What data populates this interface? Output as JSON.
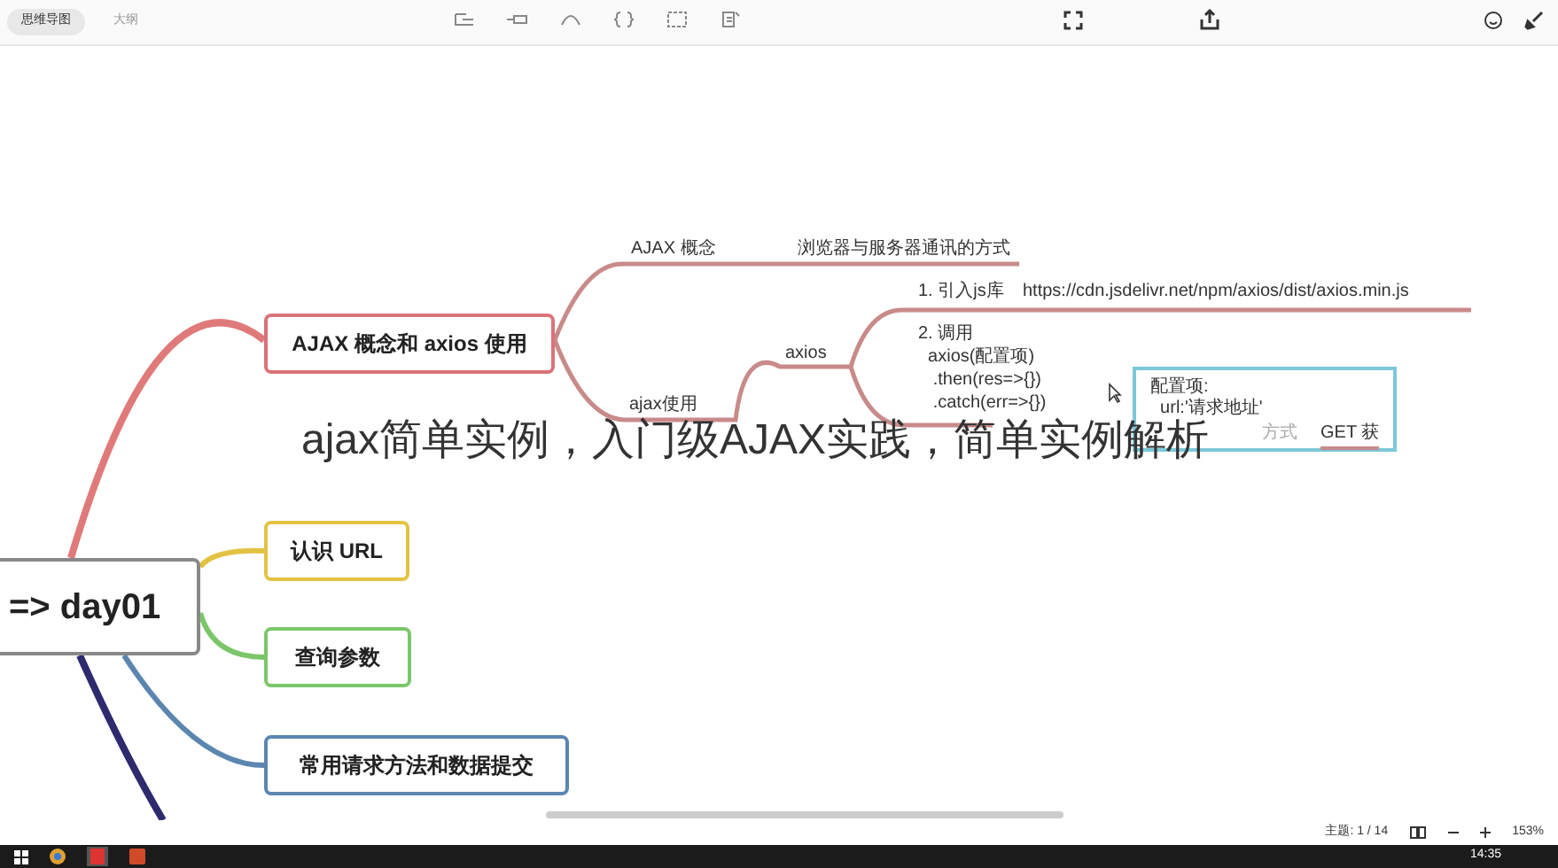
{
  "tabs": [
    {
      "label": "思维导图",
      "selected": true
    },
    {
      "label": "大纲",
      "selected": false
    }
  ],
  "mind_map": {
    "root": "=> day01",
    "topics": [
      {
        "label": "AJAX 概念和 axios 使用",
        "color": "#d9737a"
      },
      {
        "label": "认识 URL",
        "color": "#e3c243"
      },
      {
        "label": "查询参数",
        "color": "#7cc66a"
      },
      {
        "label": "常用请求方法和数据提交",
        "color": "#5b86b0"
      }
    ],
    "subtopics": [
      "AJAX 概念",
      "浏览器与服务器通讯的方式",
      "ajax使用",
      "axios",
      "1. 引入js库",
      "https://cdn.jsdelivr.net/npm/axios/dist/axios.min.js",
      "2. 调用\n  axios(配置项)\n   .then(res=>{})\n   .catch(err=>{})"
    ],
    "note": {
      "lines": [
        "配置项:",
        "  url:'请求地址'"
      ]
    },
    "partial_texts": [
      "方式",
      "GET 获"
    ]
  },
  "caption": "ajax简单实例，入门级AJAX实践，简单实例解析",
  "status_bar": {
    "topic_count": "主题: 1 / 14",
    "zoom": "153%"
  },
  "taskbar": {
    "clock": "14:35"
  }
}
